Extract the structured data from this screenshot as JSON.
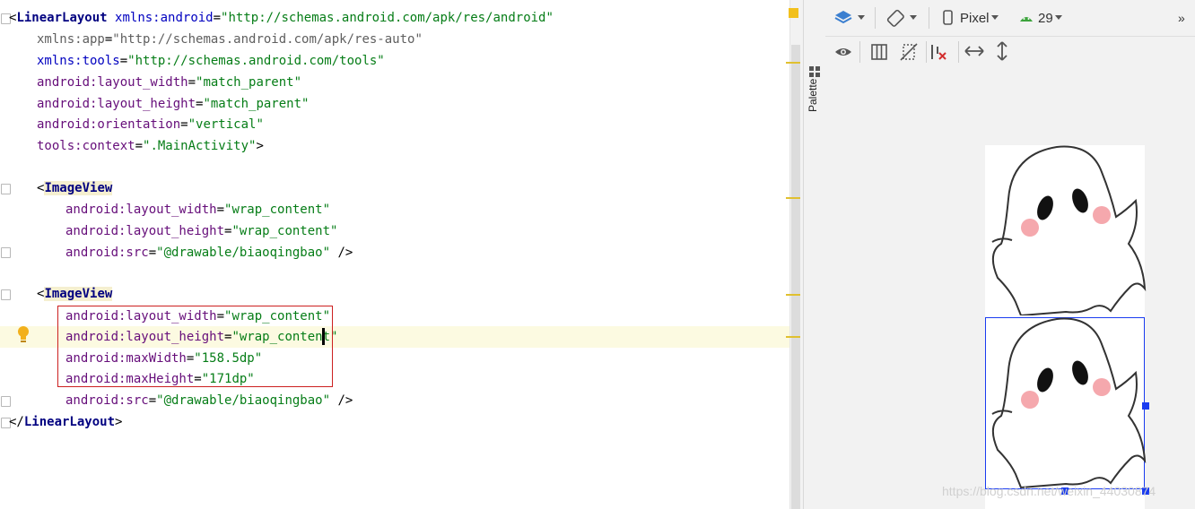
{
  "editor": {
    "lines": {
      "l1_tag": "LinearLayout",
      "l1_attr": "xmlns:android",
      "l1_val": "\"http://schemas.android.com/apk/res/android\"",
      "l2_attr": "xmlns:app",
      "l2_val": "\"http://schemas.android.com/apk/res-auto\"",
      "l3_attr": "xmlns:tools",
      "l3_val": "\"http://schemas.android.com/tools\"",
      "l4_attr": "android:layout_width",
      "l4_val": "\"match_parent\"",
      "l5_attr": "android:layout_height",
      "l5_val": "\"match_parent\"",
      "l6_attr": "android:orientation",
      "l6_val": "\"vertical\"",
      "l7_attr": "tools:context",
      "l7_val": "\".MainActivity\"",
      "iv1_tag": "ImageView",
      "iv1_w_attr": "android:layout_width",
      "iv1_w_val": "\"wrap_content\"",
      "iv1_h_attr": "android:layout_height",
      "iv1_h_val": "\"wrap_content\"",
      "iv1_src_attr": "android:src",
      "iv1_src_val": "\"@drawable/biaoqingbao\"",
      "iv2_tag": "ImageView",
      "iv2_w_attr": "android:layout_width",
      "iv2_w_val": "\"wrap_content\"",
      "iv2_h_attr": "android:layout_height",
      "iv2_h_val": "\"wrap_content\"",
      "iv2_mw_attr": "android:maxWidth",
      "iv2_mw_val": "\"158.5dp\"",
      "iv2_mh_attr": "android:maxHeight",
      "iv2_mh_val": "\"171dp\"",
      "iv2_src_attr": "android:src",
      "iv2_src_val": "\"@drawable/biaoqingbao\"",
      "close_tag": "LinearLayout"
    }
  },
  "sidebar": {
    "palette_label": "Palette"
  },
  "toolbar": {
    "device": "Pixel",
    "api_level": "29",
    "overflow": "»"
  },
  "watermark": "https://blog.csdn.net/weixin_44030874",
  "colors": {
    "selection": "#1a3cf0",
    "highlight_box": "#cc2020",
    "bulb": "#f2b01c"
  }
}
